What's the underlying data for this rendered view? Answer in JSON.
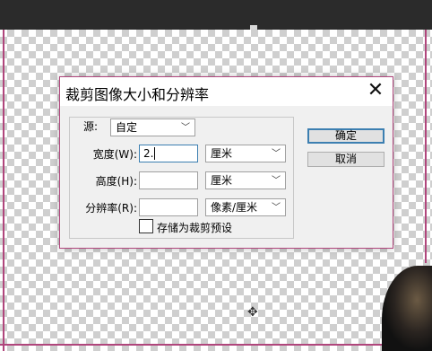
{
  "dialog": {
    "title": "裁剪图像大小和分辨率",
    "close_icon": "close-icon",
    "source_label": "源:",
    "source_value": "自定",
    "width_label": "宽度(W):",
    "width_value": "2.",
    "width_unit": "厘米",
    "height_label": "高度(H):",
    "height_value": "",
    "height_unit": "厘米",
    "resolution_label": "分辨率(R):",
    "resolution_value": "",
    "resolution_unit": "像素/厘米",
    "save_preset_label": "存储为裁剪预设",
    "save_preset_checked": false,
    "ok_label": "确定",
    "cancel_label": "取消"
  },
  "colors": {
    "selection_edge": "#b0467c",
    "focus_blue": "#3c7fb1"
  }
}
